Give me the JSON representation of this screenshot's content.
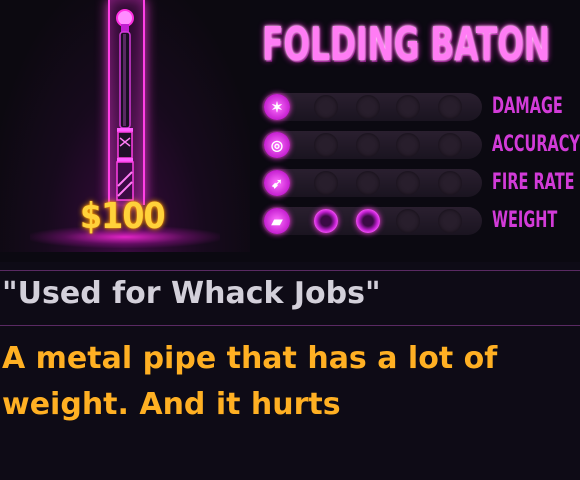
{
  "weapon": {
    "name": "FOLDING BATON",
    "price": "$100",
    "quote": "\"Used for Whack Jobs\"",
    "description": "A metal pipe that has a lot of weight. And it hurts"
  },
  "stats": [
    {
      "label": "DAMAGE",
      "icon": "damage-icon",
      "value": 0,
      "max": 5
    },
    {
      "label": "ACCURACY",
      "icon": "accuracy-icon",
      "value": 0,
      "max": 5
    },
    {
      "label": "FIRE RATE",
      "icon": "fire-rate-icon",
      "value": 0,
      "max": 5
    },
    {
      "label": "WEIGHT",
      "icon": "weight-icon",
      "value": 2,
      "max": 5
    }
  ],
  "colors": {
    "background": "#0e0b16",
    "neon_pink": "#ff3fe6",
    "price_gold": "#ffd23a",
    "description_orange": "#ffb023",
    "quote_gray": "#d3d0da",
    "stat_label": "#d23bd8"
  }
}
